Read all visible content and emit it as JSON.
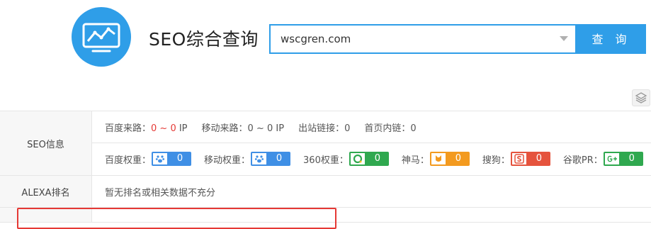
{
  "header": {
    "title": "SEO综合查询",
    "search_value": "wscgren.com",
    "search_button": "查 询"
  },
  "colors": {
    "accent": "#2f9ee8",
    "highlight": "#e53935"
  },
  "seo_row": {
    "label": "SEO信息",
    "stats": [
      {
        "label": "百度来路：",
        "value": "0 ~ 0",
        "unit": " IP"
      },
      {
        "label": "移动来路：",
        "value": "0 ~ 0",
        "unit": " IP"
      },
      {
        "label": "出站链接：",
        "value": "0",
        "unit": ""
      },
      {
        "label": "首页内链：",
        "value": "0",
        "unit": ""
      }
    ],
    "weights": [
      {
        "label": "百度权重：",
        "icon": "paw-icon",
        "value": "0"
      },
      {
        "label": "移动权重：",
        "icon": "paw-icon",
        "value": "0"
      },
      {
        "label": "360权重：",
        "icon": "360-icon",
        "value": "0"
      },
      {
        "label": "神马：",
        "icon": "shenma-icon",
        "value": "0"
      },
      {
        "label": "搜狗：",
        "icon": "sogou-icon",
        "value": "0"
      },
      {
        "label": "谷歌PR：",
        "icon": "google-plus-icon",
        "value": "0"
      }
    ]
  },
  "alexa_row": {
    "label": "ALEXA排名",
    "value": "暂无排名或相关数据不充分"
  }
}
